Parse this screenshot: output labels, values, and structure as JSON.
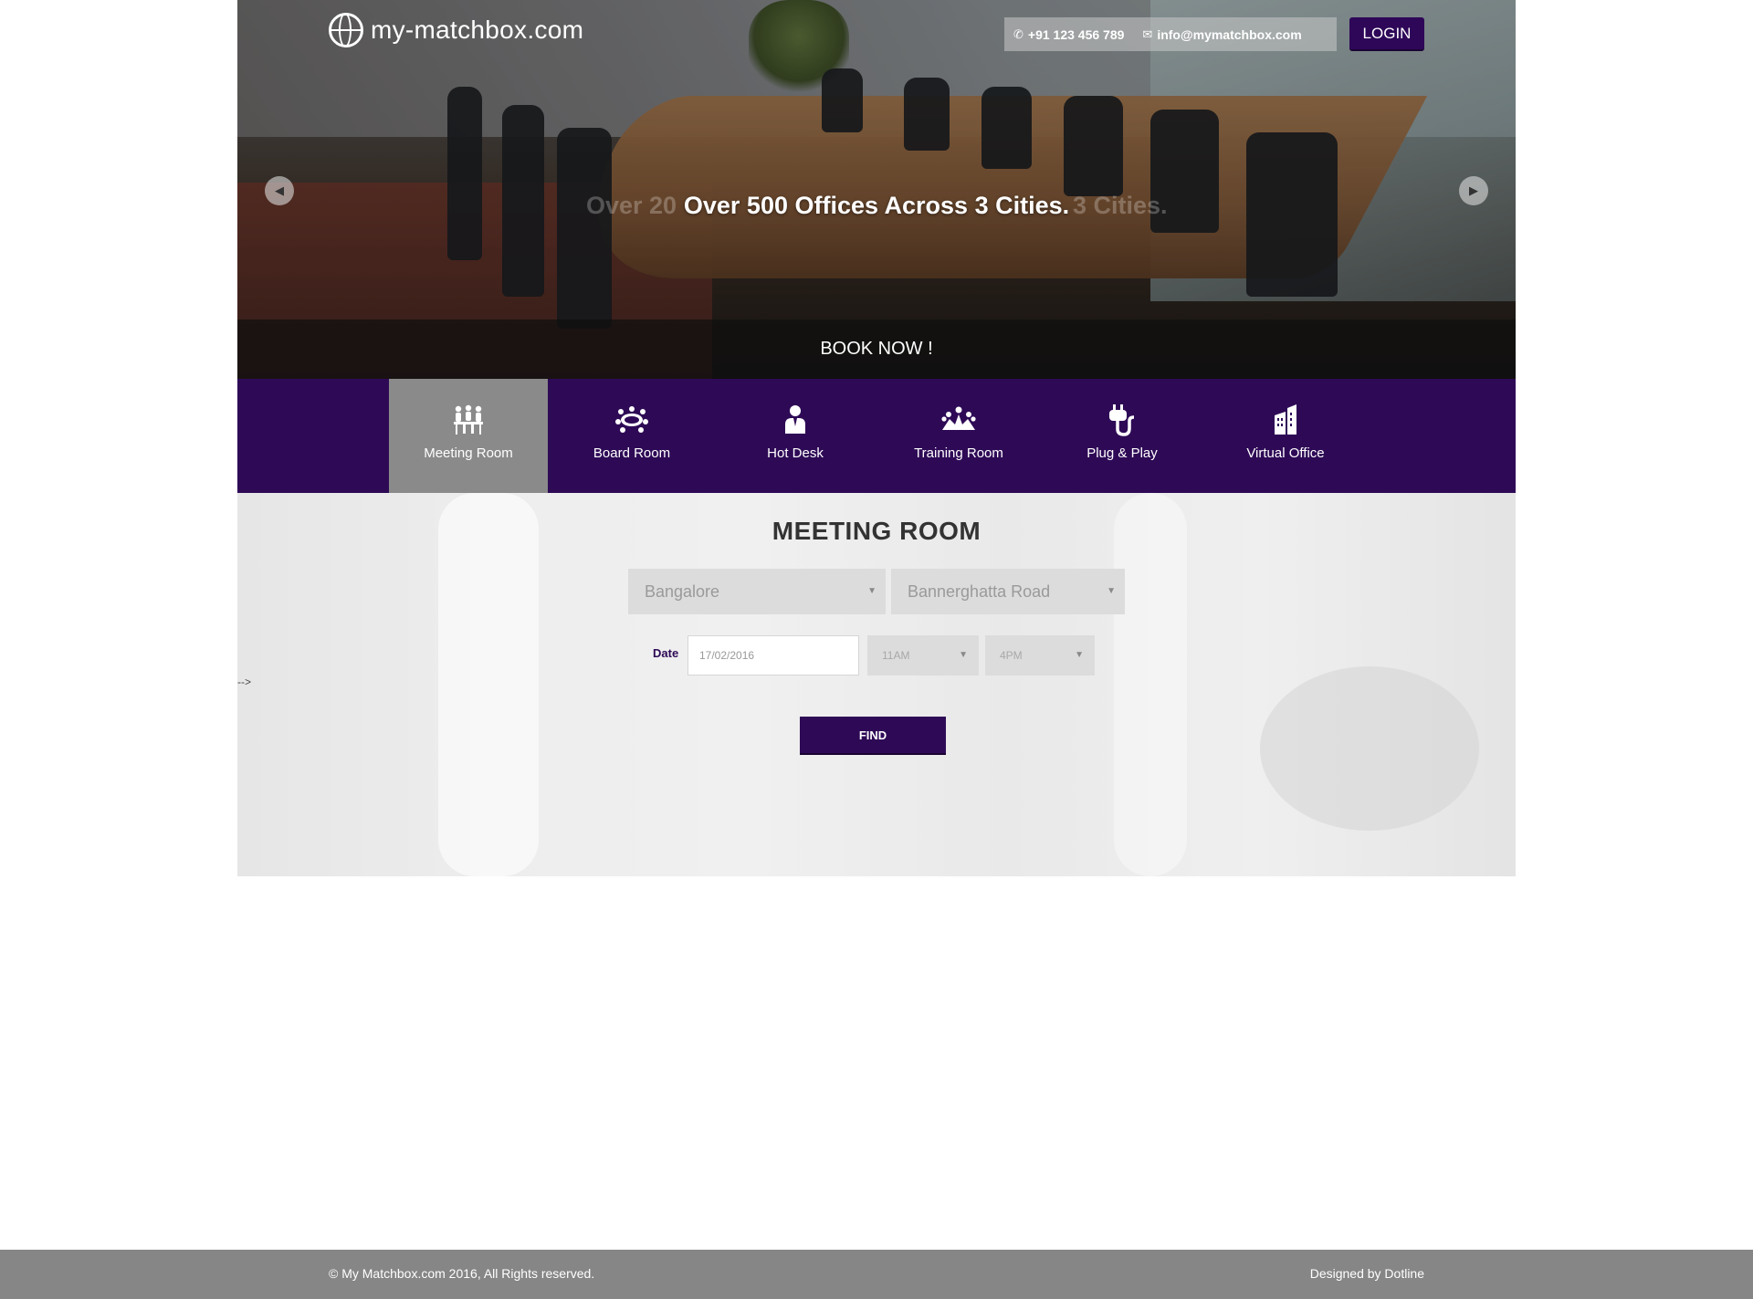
{
  "header": {
    "logo_text": "my-matchbox.com",
    "phone": "+91 123 456 789",
    "email": "info@mymatchbox.com",
    "login_label": "LOGIN"
  },
  "hero": {
    "slide_title": "Over 500 Offices Across 3 Cities.",
    "ghost_left": "Over 20",
    "ghost_right": "3 Cities.",
    "book_now_label": "BOOK NOW !"
  },
  "categories": [
    {
      "label": "Meeting Room",
      "icon": "meeting-room-icon",
      "active": true
    },
    {
      "label": "Board Room",
      "icon": "board-room-icon",
      "active": false
    },
    {
      "label": "Hot Desk",
      "icon": "hot-desk-icon",
      "active": false
    },
    {
      "label": "Training Room",
      "icon": "training-room-icon",
      "active": false
    },
    {
      "label": "Plug & Play",
      "icon": "plug-and-play-icon",
      "active": false
    },
    {
      "label": "Virtual Office",
      "icon": "virtual-office-icon",
      "active": false
    }
  ],
  "search": {
    "title": "MEETING ROOM",
    "city_value": "Bangalore",
    "area_value": "Bannerghatta Road",
    "date_label": "Date",
    "date_value": "17/02/2016",
    "from_time": "11AM",
    "to_time": "4PM",
    "find_label": "FIND",
    "stray_text": "-->"
  },
  "footer": {
    "copyright": "© My Matchbox.com 2016, All Rights reserved.",
    "designer": "Designed by Dotline"
  },
  "colors": {
    "brand_purple": "#2e0a56",
    "active_tab": "#8a8a8a",
    "footer_bg": "#868686"
  }
}
